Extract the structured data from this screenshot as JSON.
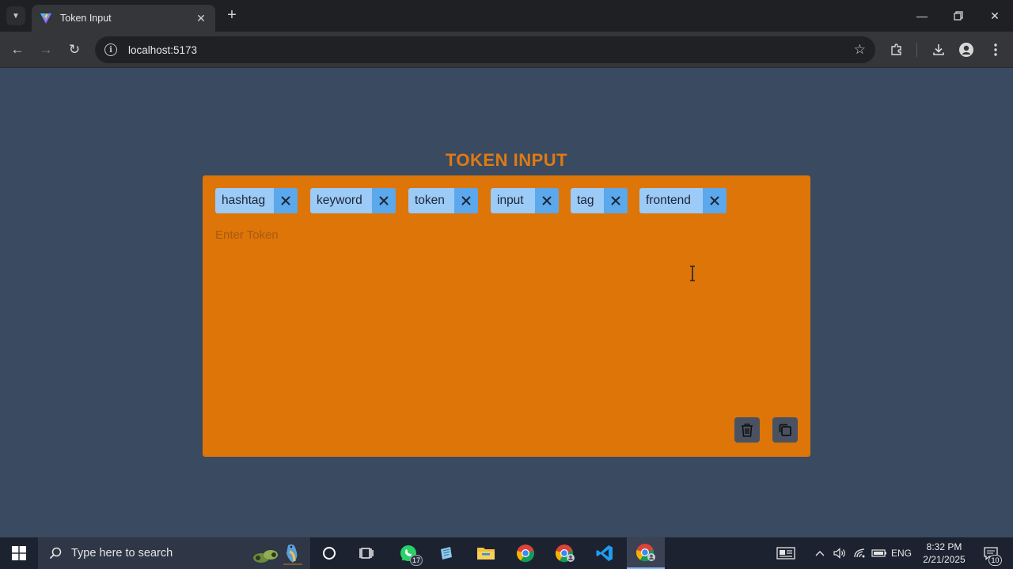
{
  "browser": {
    "tab_title": "Token Input",
    "url": "localhost:5173"
  },
  "app": {
    "title": "TOKEN INPUT",
    "input_placeholder": "Enter Token",
    "tokens": [
      {
        "label": "hashtag"
      },
      {
        "label": "keyword"
      },
      {
        "label": "token"
      },
      {
        "label": "input"
      },
      {
        "label": "tag"
      },
      {
        "label": "frontend"
      }
    ],
    "actions": {
      "delete_icon": "trash-icon",
      "copy_icon": "copy-icon"
    }
  },
  "taskbar": {
    "search_placeholder": "Type here to search",
    "whatsapp_badge": "17",
    "language": "ENG",
    "time": "8:32 PM",
    "date": "2/21/2025",
    "notification_count": "10"
  },
  "colors": {
    "page_bg": "#3a4a60",
    "panel_bg": "#dd7508",
    "title": "#e07a12",
    "token_bg": "#9ccbf7",
    "token_remove_bg": "#5ba8ec",
    "action_bg": "#4a5262"
  }
}
